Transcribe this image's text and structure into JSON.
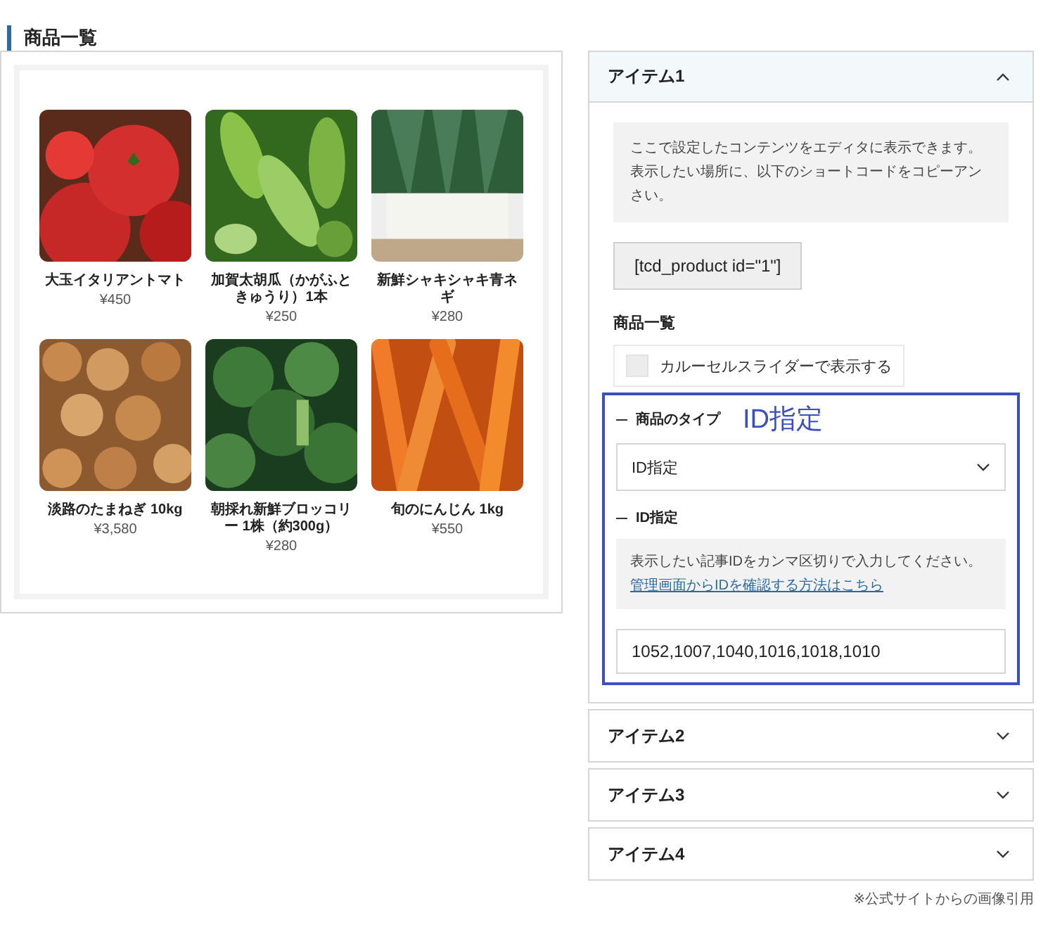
{
  "heading": "商品一覧",
  "products": [
    {
      "name": "大玉イタリアントマト",
      "price": "¥450"
    },
    {
      "name": "加賀太胡瓜（かがふときゅうり）1本",
      "price": "¥250"
    },
    {
      "name": "新鮮シャキシャキ青ネギ",
      "price": "¥280"
    },
    {
      "name": "淡路のたまねぎ 10kg",
      "price": "¥3,580"
    },
    {
      "name": "朝採れ新鮮ブロッコリー 1株（約300g）",
      "price": "¥280"
    },
    {
      "name": "旬のにんじん 1kg",
      "price": "¥550"
    }
  ],
  "accordion": [
    {
      "title": "アイテム1",
      "expanded": true
    },
    {
      "title": "アイテム2",
      "expanded": false
    },
    {
      "title": "アイテム3",
      "expanded": false
    },
    {
      "title": "アイテム4",
      "expanded": false
    }
  ],
  "item1": {
    "note": "ここで設定したコンテンツをエディタに表示できます。表示したい場所に、以下のショートコードをコピーアンさい。",
    "shortcode": "[tcd_product id=\"1\"]",
    "section_title": "商品一覧",
    "carousel": {
      "label": "カルーセルスライダーで表示する",
      "checked": false
    },
    "type_label": "商品のタイプ",
    "annotation": "ID指定",
    "type_select": "ID指定",
    "id_label": "ID指定",
    "id_help": "表示したい記事IDをカンマ区切りで入力してください。",
    "id_link": "管理画面からIDを確認する方法はこちら",
    "id_value": "1052,1007,1040,1016,1018,1010"
  },
  "footnote": "※公式サイトからの画像引用"
}
